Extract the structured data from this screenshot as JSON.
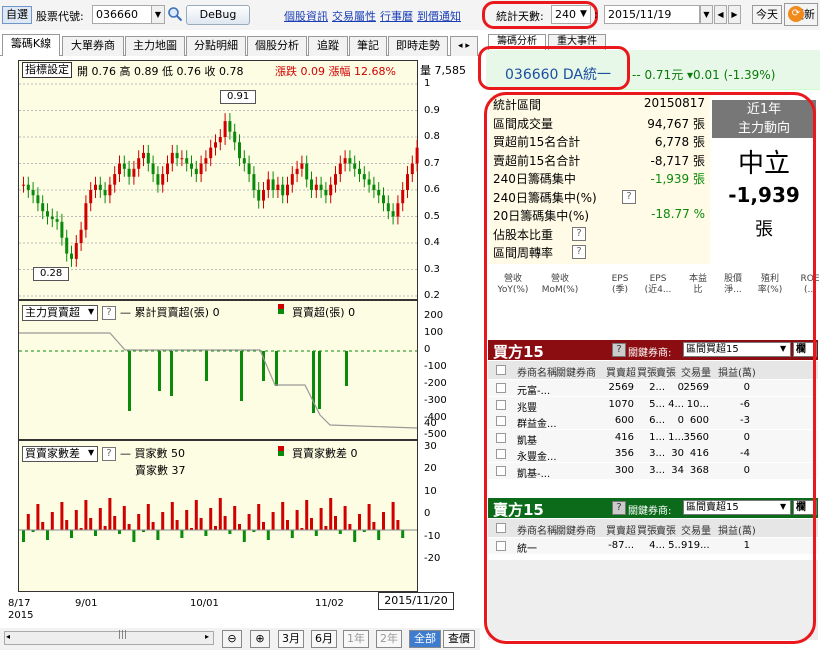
{
  "toolbar": {
    "watch_label": "自選",
    "stock_label": "股票代號:",
    "stock_code": "036660",
    "debug_label": "DeBug",
    "links": [
      "個股資訊",
      "交易屬性",
      "行事曆",
      "到價通知"
    ],
    "stat_days_label": "統計天數:",
    "stat_days": "240",
    "date_value": "2015/11/19",
    "today_label": "今天",
    "update_label": "更新"
  },
  "left_tabs": [
    "籌碼K線",
    "大單券商",
    "主力地圖",
    "分點明細",
    "個股分析",
    "追蹤",
    "筆記",
    "即時走勢"
  ],
  "kline": {
    "settings_label": "指標設定",
    "ohlc": "開 0.76 高 0.89 低 0.76 收 0.78",
    "change": "漲跌 0.09 漲幅 12.68%",
    "volume_label": "量 7,585",
    "y_ticks": [
      "1",
      "0.9",
      "0.8",
      "0.7",
      "0.6",
      "0.5",
      "0.4",
      "0.3",
      "0.2"
    ],
    "high_callout": "0.91",
    "low_callout": "0.28"
  },
  "panel2": {
    "dropdown": "主力買賣超",
    "legend1": "累計買賣超(張) 0",
    "legend2": "買賣超(張) 0",
    "y_ticks": [
      "200",
      "100",
      "0",
      "-100",
      "-200",
      "-300",
      "-400",
      "-500"
    ]
  },
  "panel3": {
    "dropdown": "買賣家數差",
    "legend1": "買家數 50",
    "legend1b": "賣家數 37",
    "legend2": "買賣家數差 0",
    "y_ticks": [
      "40",
      "30",
      "20",
      "10",
      "0",
      "-10",
      "-20"
    ]
  },
  "x_axis": {
    "labels": [
      "8/17",
      "9/01",
      "10/01",
      "11/02"
    ],
    "year": "2015",
    "current_date": "2015/11/20"
  },
  "bottom": {
    "zoom_out": "−",
    "zoom_in": "+",
    "periods": [
      "3月",
      "6月",
      "1年",
      "2年",
      "全部",
      "查價"
    ]
  },
  "right_tabs": [
    "籌碼分析",
    "重大事件"
  ],
  "stock_header": {
    "code_name": "036660  DA統一",
    "price": "-- 0.71元  ▾0.01 (-1.39%)"
  },
  "stats": {
    "rows": [
      {
        "label": "統計區間",
        "value": "20150817"
      },
      {
        "label": "區間成交量",
        "value": "94,767 張"
      },
      {
        "label": "買超前15名合計",
        "value": "6,778 張"
      },
      {
        "label": "賣超前15名合計",
        "value": "-8,717 張"
      },
      {
        "label": "240日籌碼集中",
        "value": "-1,939 張"
      },
      {
        "label": "240日籌碼集中(%)",
        "value": ""
      },
      {
        "label": "20日籌碼集中(%)",
        "value": "-18.77 %"
      },
      {
        "label": "佔股本比重",
        "value": ""
      },
      {
        "label": "區間周轉率",
        "value": ""
      }
    ]
  },
  "main_force": {
    "head1": "近1年",
    "head2": "主力動向",
    "status": "中立",
    "value": "-1,939",
    "unit": "張"
  },
  "metrics": [
    "營收\nYoY(%)",
    "營收\nMoM(%)",
    "EPS\n(季)",
    "EPS\n(近4...",
    "本益\n比",
    "股價\n淨...",
    "殖利\n率(%)",
    "ROE\n(..."
  ],
  "buy15": {
    "title": "買方15",
    "key_label": "關鍵券商:",
    "select": "區間買超15",
    "cols_btn": "欄",
    "headers": [
      "券商名稱",
      "關鍵券商",
      "買賣超",
      "買張",
      "賣張",
      "交易量",
      "損益(萬)"
    ],
    "rows": [
      [
        "元富-...",
        "",
        "2569",
        "2...",
        "0",
        "2569",
        "0"
      ],
      [
        "兆豐",
        "",
        "1070",
        "5...",
        "4...",
        "10...",
        "-6"
      ],
      [
        "群益金...",
        "",
        "600",
        "6...",
        "0",
        "600",
        "-3"
      ],
      [
        "凱基",
        "",
        "416",
        "1...",
        "1...",
        "3560",
        "0"
      ],
      [
        "永豐金...",
        "",
        "356",
        "3...",
        "30",
        "416",
        "-4"
      ],
      [
        "凱基-...",
        "",
        "300",
        "3...",
        "34",
        "368",
        "0"
      ]
    ]
  },
  "sell15": {
    "title": "賣方15",
    "key_label": "關鍵券商:",
    "select": "區間賣超15",
    "cols_btn": "欄",
    "headers": [
      "券商名稱",
      "關鍵券商",
      "買賣超",
      "買張",
      "賣張",
      "交易量",
      "損益(萬)"
    ],
    "rows": [
      [
        "統一",
        "",
        "-87...",
        "4...",
        "5...",
        "919...",
        "1"
      ]
    ]
  },
  "colors": {
    "up": "#d10000",
    "down": "#0a8a0a",
    "accent": "#e8181c"
  }
}
